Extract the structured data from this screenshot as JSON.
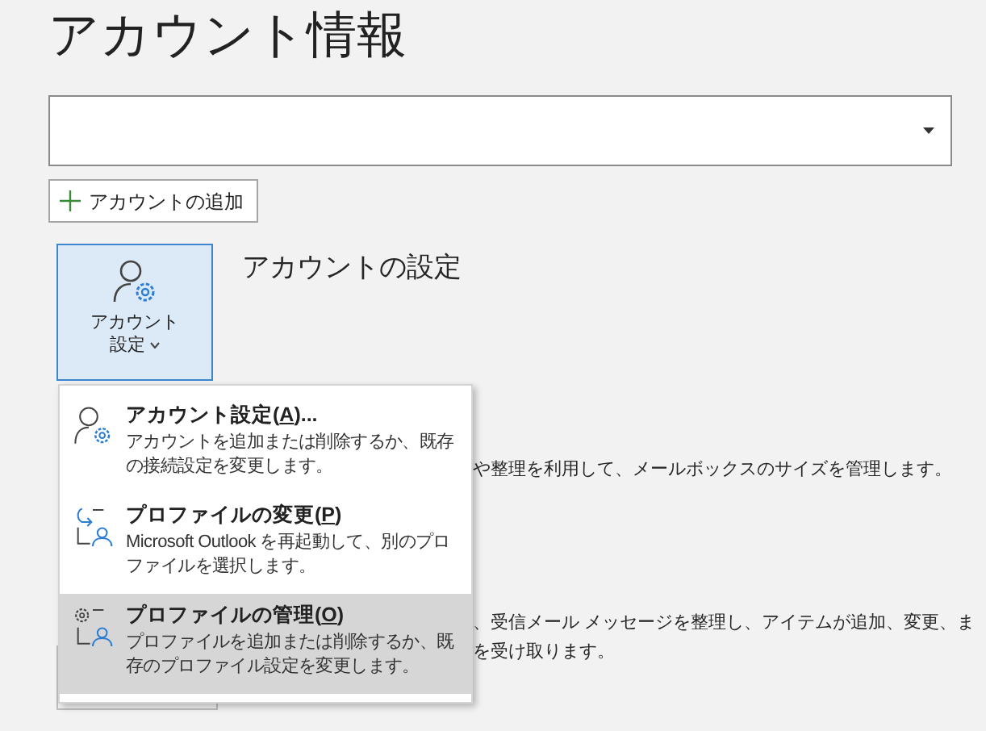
{
  "page_title": "アカウント情報",
  "add_account_button": {
    "label": "アカウントの追加"
  },
  "account_settings": {
    "label_lines": [
      "アカウント",
      "設定"
    ],
    "expanded": true,
    "heading": "アカウントの設定"
  },
  "menu": [
    {
      "kind": "account-settings",
      "title_before": "アカウント設定(",
      "access_key": "A",
      "title_after": ")...",
      "description": "アカウントを追加または削除するか、既存の接続設定を変更します。",
      "selected": false
    },
    {
      "kind": "change-profile",
      "title_before": "プロファイルの変更(",
      "access_key": "P",
      "title_after": ")",
      "description": "Microsoft Outlook を再起動して、別のプロファイルを選択します。",
      "selected": false
    },
    {
      "kind": "manage-profile",
      "title_before": "プロファイルの管理(",
      "access_key": "O",
      "title_after": ")",
      "description": "プロファイルを追加または削除するか、既存のプロファイル設定を変更します。",
      "selected": true
    }
  ],
  "background_sections": [
    {
      "description_lines": [
        "や整理を利用して、メールボックスのサイズを管理します。"
      ]
    },
    {
      "description_lines": [
        "、受信メール メッセージを整理し、アイテムが追加、変更、ま",
        "を受け取ります。"
      ]
    }
  ]
}
